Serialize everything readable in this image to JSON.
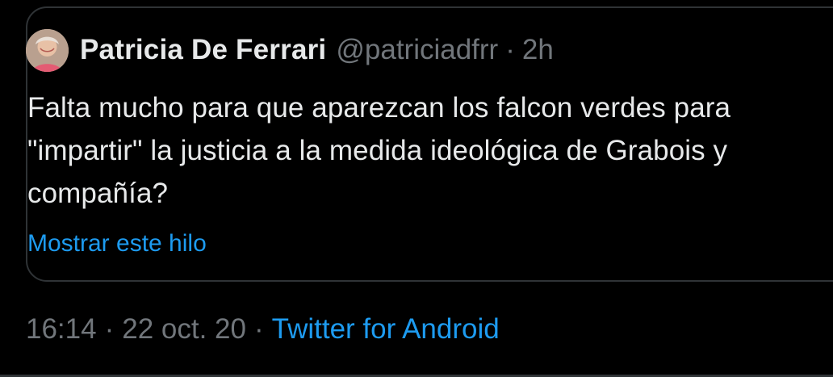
{
  "quoted_tweet": {
    "author": {
      "name": "Patricia De Ferrari",
      "handle": "@patriciadfrr",
      "separator": "·",
      "time_ago": "2h",
      "avatar_icon": "profile-photo"
    },
    "text": "Falta mucho para que aparezcan los falcon verdes para \"impartir\" la justicia a la medida ideológica de Grabois y compañía?",
    "show_thread_label": "Mostrar este hilo"
  },
  "tweet_meta": {
    "time": "16:14",
    "separator": "·",
    "date": "22 oct. 20",
    "separator_2": "·",
    "source": "Twitter for Android"
  },
  "colors": {
    "background": "#000000",
    "border": "#2f3336",
    "text_primary": "#e7e9ea",
    "text_secondary": "#71767b",
    "link": "#1d9bf0"
  }
}
